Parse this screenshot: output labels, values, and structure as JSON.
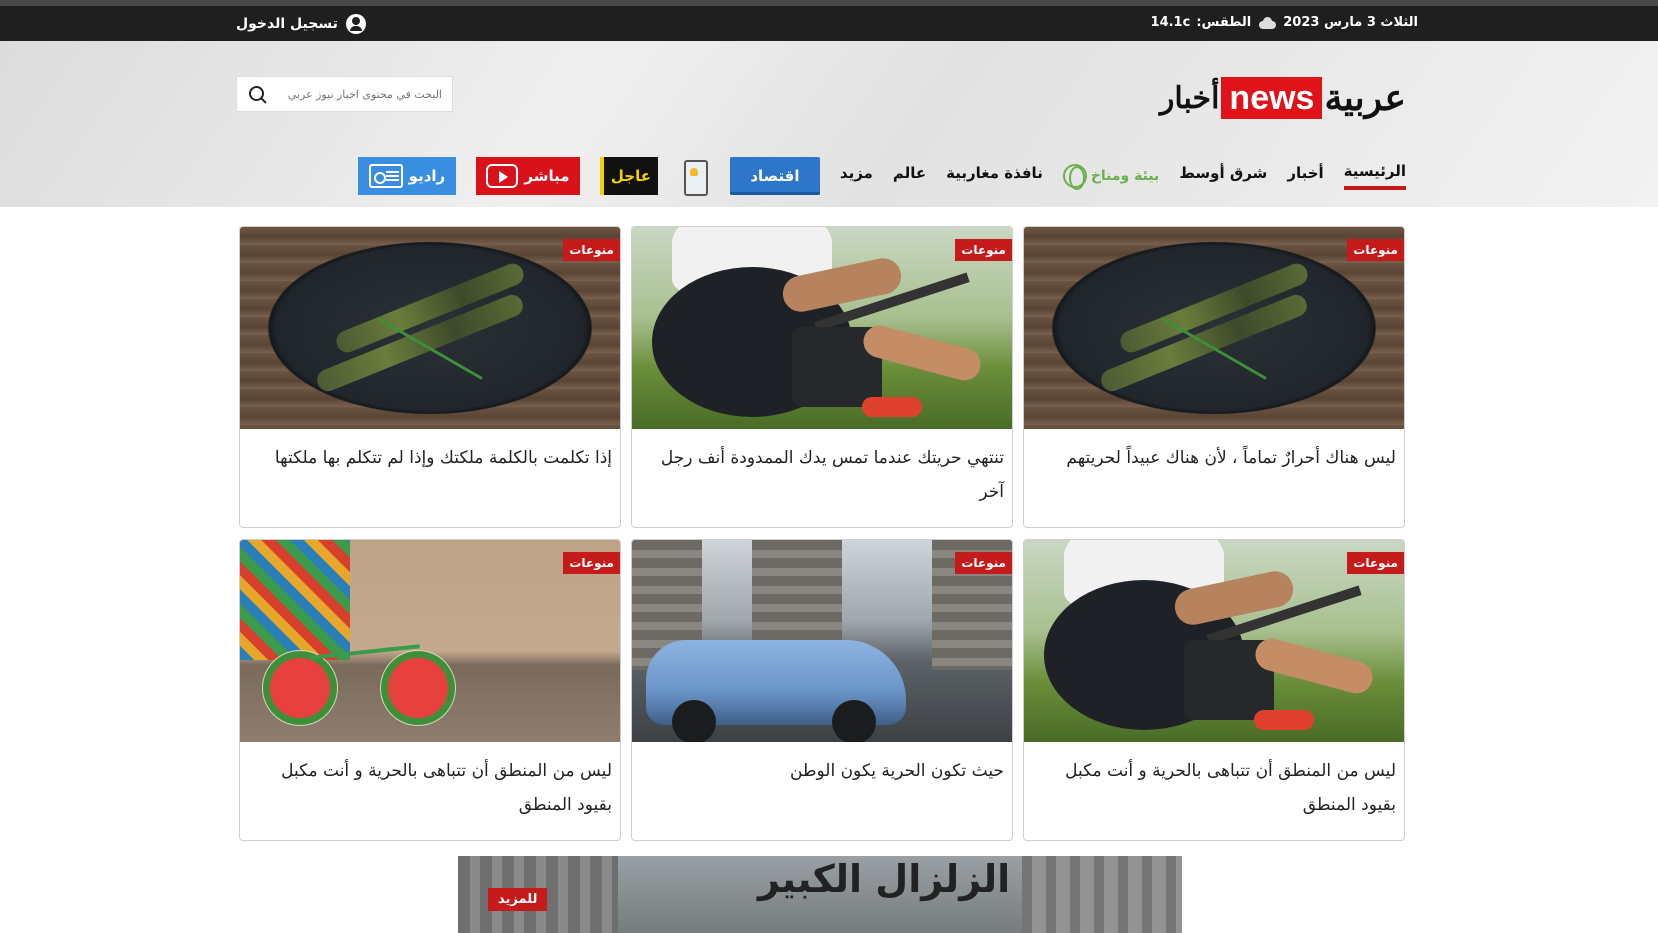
{
  "topbar": {
    "date": "الثلاث 3 مارس 2023",
    "weather_label": "الطقس:",
    "weather_value": "14.1c",
    "login": "تسجيل الدخول"
  },
  "logo": {
    "part1": "عربية",
    "part2": "news",
    "part3": "أخبار"
  },
  "search": {
    "placeholder": "البحث في محتوى اخبار نيوز عربي"
  },
  "nav": {
    "items": [
      "الرئيسية",
      "أخبار",
      "شرق أوسط",
      "نافذة مغاربية",
      "عالم",
      "مزيد"
    ],
    "green_logo": "بيئة ومناخ",
    "economy": "اقتصاد",
    "urgent": "عاجل",
    "live": "مباشر",
    "radio": "راديو"
  },
  "cards": [
    {
      "badge": "منوعات",
      "title": "ليس هناك أحرارٌ تماماً ، لأن هناك عبيداً لحريتهم"
    },
    {
      "badge": "منوعات",
      "title": "تنتهي حريتك عندما تمس يدك الممدودة أنف رجل آخر"
    },
    {
      "badge": "منوعات",
      "title": "إذا تكلمت بالكلمة ملكتك وإذا لم تتكلم بها ملكتها"
    },
    {
      "badge": "منوعات",
      "title": "ليس من المنطق أن تتباهى بالحرية و أنت مكبل بقيود المنطق"
    },
    {
      "badge": "منوعات",
      "title": "حيث تكون الحرية يكون الوطن"
    },
    {
      "badge": "منوعات",
      "title": "ليس من المنطق أن تتباهى بالحرية و أنت مكبل بقيود المنطق"
    }
  ],
  "banner": {
    "title": "الزلزال الكبير",
    "more": "للمزيد"
  },
  "colors": {
    "accent_red": "#c61b1b",
    "topbar": "#1f1f1f",
    "economy_blue": "#2e76c9",
    "urgent_yellow": "#f3d000"
  }
}
